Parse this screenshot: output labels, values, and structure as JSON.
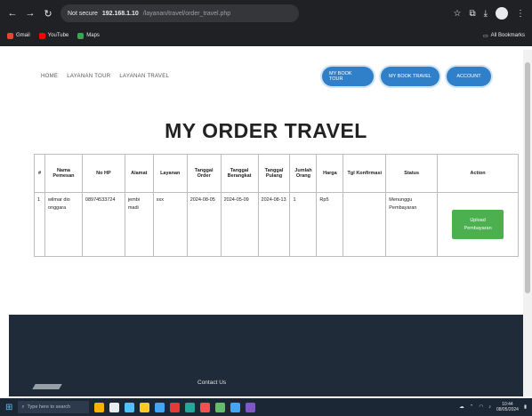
{
  "browser": {
    "url_secure": "Not secure",
    "url_host": "192.168.1.10",
    "url_path": "/layanan/travel/order_travel.php",
    "bookmarks": [
      {
        "label": "Gmail",
        "color": "#ea4335"
      },
      {
        "label": "YouTube",
        "color": "#ff0000"
      },
      {
        "label": "Maps",
        "color": "#34a853"
      }
    ],
    "all_bookmarks": "All Bookmarks"
  },
  "nav": {
    "links": [
      "HOME",
      "LAYANAN TOUR",
      "LAYANAN TRAVEL"
    ],
    "buttons": [
      "MY BOOK TOUR",
      "MY BOOK TRAVEL",
      "ACCOUNT"
    ]
  },
  "page_title": "MY ORDER TRAVEL",
  "table": {
    "headers": [
      "#",
      "Nama Pemesan",
      "No HP",
      "Alamat",
      "Layanan",
      "Tanggal Order",
      "Tanggal Berangkat",
      "Tanggal Pulang",
      "Jumlah Orang",
      "Harga",
      "Tgl Konfirmasi",
      "Status",
      "Action"
    ],
    "rows": [
      {
        "no": "1",
        "nama": "wilmar dio onggara",
        "hp": "08974533724",
        "alamat": "jembi madi",
        "layanan": "xxx",
        "tgl_order": "2024-08-05",
        "tgl_berangkat": "2024-05-09",
        "tgl_pulang": "2024-08-13",
        "jumlah": "1",
        "harga": "Rp5",
        "tgl_konfirmasi": "",
        "status": "Menunggu Pembayaran",
        "action": "Upload Pembayaran"
      }
    ]
  },
  "footer": {
    "contact": "Contact Us"
  },
  "taskbar": {
    "search_placeholder": "Type here to search",
    "icons": [
      "#f4b400",
      "#e8eaed",
      "#4fc3f7",
      "#ffca28",
      "#42a5f5",
      "#e53935",
      "#26a69a",
      "#ef5350",
      "#66bb6a",
      "#42a5f5",
      "#7e57c2"
    ],
    "time": "10:44",
    "date": "08/05/2024"
  }
}
